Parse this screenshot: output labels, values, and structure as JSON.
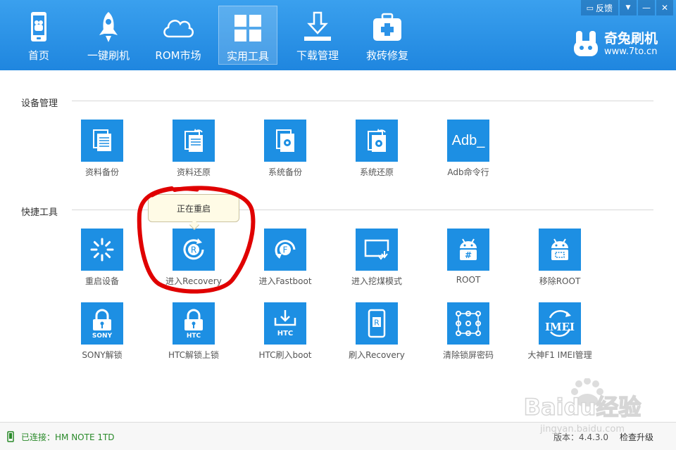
{
  "window": {
    "feedback_label": "反馈",
    "dropdown_glyph": "▼",
    "minimize_glyph": "—",
    "close_glyph": "✕"
  },
  "nav": {
    "items": [
      {
        "label": "首页",
        "icon": "phone-icon"
      },
      {
        "label": "一键刷机",
        "icon": "rocket-icon"
      },
      {
        "label": "ROM市场",
        "icon": "cloud-icon"
      },
      {
        "label": "实用工具",
        "icon": "grid-icon",
        "active": true
      },
      {
        "label": "下载管理",
        "icon": "download-icon"
      },
      {
        "label": "救砖修复",
        "icon": "medkit-icon"
      }
    ]
  },
  "brand": {
    "name": "奇兔刷机",
    "url": "www.7to.cn"
  },
  "sections": {
    "device": {
      "title": "设备管理",
      "items": [
        {
          "label": "资料备份",
          "icon": "document-copy-icon"
        },
        {
          "label": "资料还原",
          "icon": "document-restore-icon"
        },
        {
          "label": "系统备份",
          "icon": "system-backup-icon"
        },
        {
          "label": "系统还原",
          "icon": "system-restore-icon"
        },
        {
          "label": "Adb命令行",
          "icon": "adb-icon",
          "icon_text": "Adb_"
        }
      ]
    },
    "quick": {
      "title": "快捷工具",
      "items": [
        {
          "label": "重启设备",
          "icon": "loading-spinner-icon"
        },
        {
          "label": "进入Recovery",
          "icon": "recovery-icon",
          "icon_text": "R"
        },
        {
          "label": "进入Fastboot",
          "icon": "fastboot-icon",
          "icon_text": "F"
        },
        {
          "label": "进入挖煤模式",
          "icon": "download-mode-icon"
        },
        {
          "label": "ROOT",
          "icon": "android-root-icon",
          "icon_text": "#"
        },
        {
          "label": "移除ROOT",
          "icon": "android-unroot-icon"
        },
        {
          "label": "SONY解锁",
          "icon": "lock-sony-icon",
          "icon_text": "SONY"
        },
        {
          "label": "HTC解锁上锁",
          "icon": "lock-htc-icon",
          "icon_text": "HTC"
        },
        {
          "label": "HTC刷入boot",
          "icon": "htc-boot-icon",
          "icon_text": "HTC"
        },
        {
          "label": "刷入Recovery",
          "icon": "flash-recovery-icon",
          "icon_text": "R"
        },
        {
          "label": "清除锁屏密码",
          "icon": "pattern-lock-icon"
        },
        {
          "label": "大神F1 IMEI管理",
          "icon": "imei-icon",
          "icon_text": "IMEI"
        }
      ]
    }
  },
  "tooltip": {
    "text": "正在重启"
  },
  "footer": {
    "connection": "已连接：HM NOTE 1TD",
    "version": "版本：4.4.3.0",
    "upgrade": "检查升级"
  },
  "watermark": {
    "line1": "Baidu经验",
    "line2": "jingyan.baidu.com"
  },
  "colors": {
    "header": "#2c93e8",
    "tile": "#1d8fe3",
    "annotation": "#e00000"
  }
}
